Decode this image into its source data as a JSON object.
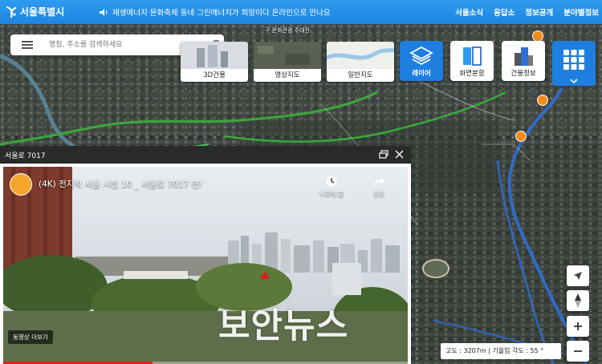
{
  "app": {
    "logo_text": "서울특별시"
  },
  "notice": {
    "text": "재생에너지 문화축제 동네 그린에너지가 희망이다 온라인으로 만나요"
  },
  "nav": [
    "서울소식",
    "응답소",
    "정보공개",
    "분야별정보"
  ],
  "search": {
    "placeholder": "명칭, 주소를 검색하세요"
  },
  "map_types": [
    "3D건물",
    "영상지도",
    "일반지도"
  ],
  "tools": [
    {
      "label": "레이어",
      "icon": "layers-icon",
      "active": true
    },
    {
      "label": "화면분할",
      "icon": "split-screen-icon",
      "active": false
    },
    {
      "label": "건물정보",
      "icon": "building-icon",
      "active": false
    },
    {
      "label": "",
      "icon": "grid-menu-icon",
      "active": false
    }
  ],
  "map_label": "구 문화관광 주대전",
  "panel": {
    "title": "서울로 7017",
    "video_title": "(4K) 전지적 서울 시점 10 _ 서울로 7017 편!",
    "watch_later": "나중에 볼",
    "share": "공유",
    "more_videos": "동영상 더보기",
    "progress": 0.37
  },
  "watermark": "보안뉴스",
  "status": {
    "text": "고도 : 3207m | 기울임 각도 : 55 °"
  },
  "colors": {
    "accent": "#1f7fe0",
    "topbar": "#2f9bf0",
    "route": "#2f6fd6",
    "green_route": "#3aa83a",
    "pin": "#f28b1f"
  }
}
